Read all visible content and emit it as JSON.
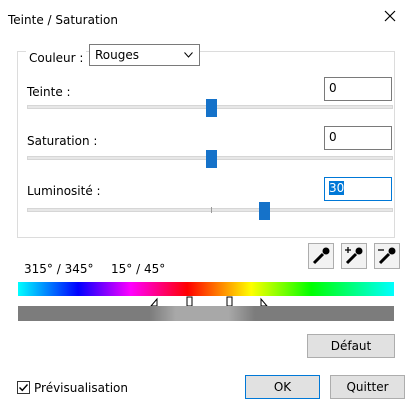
{
  "window": {
    "title": "Teinte / Saturation"
  },
  "color_group": {
    "label": "Couleur :",
    "selected": "Rouges"
  },
  "sliders": {
    "hue": {
      "label": "Teinte :",
      "value": "0",
      "level": 0.5
    },
    "saturation": {
      "label": "Saturation :",
      "value": "0",
      "level": 0.5
    },
    "lightness": {
      "label": "Luminosité :",
      "value": "30",
      "level": 0.65
    }
  },
  "range": {
    "left": "315° / 345°",
    "right": "15° / 45°"
  },
  "buttons": {
    "default": "Défaut",
    "ok": "OK",
    "cancel": "Quitter"
  },
  "preview": {
    "label": "Prévisualisation",
    "checked": true
  },
  "colors": {
    "accent": "#1572c9",
    "focus": "#0078d7"
  }
}
